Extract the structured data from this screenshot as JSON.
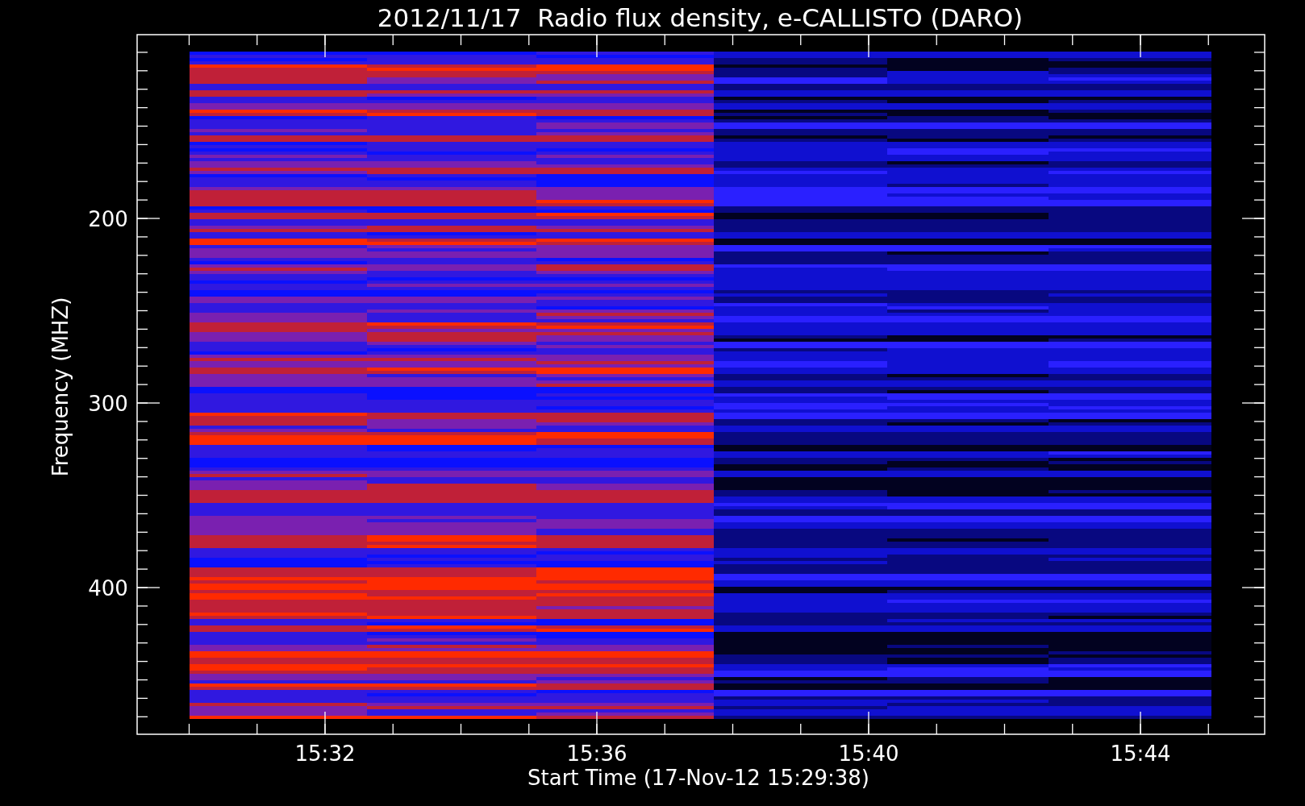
{
  "plot": {
    "title": "2012/11/17  Radio flux density, e-CALLISTO (DARO)",
    "y_axis_label": "Frequency (MHZ)",
    "y_tick_labels": [
      "200",
      "300",
      "400"
    ],
    "x_axis_label": "Start Time (17-Nov-12 15:29:38)",
    "x_tick_labels": [
      "15:32",
      "15:36",
      "15:40",
      "15:44"
    ]
  }
}
